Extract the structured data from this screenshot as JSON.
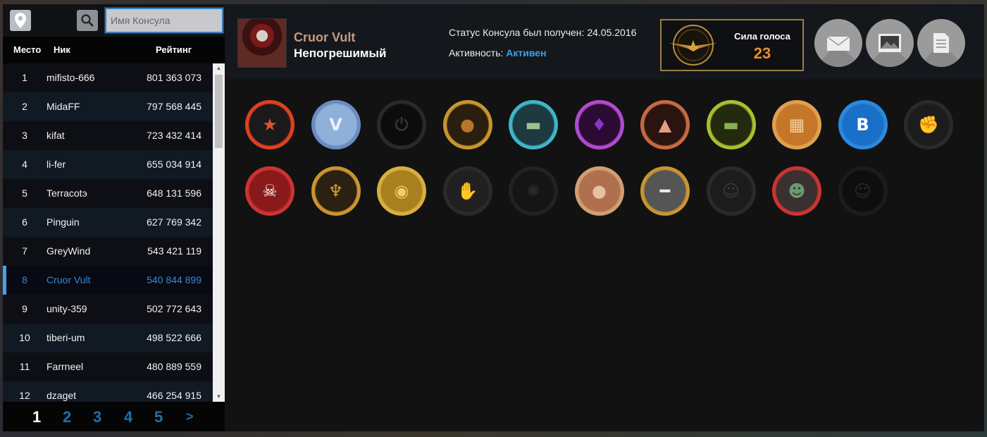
{
  "search": {
    "placeholder": "Имя Консула"
  },
  "table": {
    "headers": {
      "place": "Место",
      "nick": "Ник",
      "rating": "Рейтинг"
    },
    "rows": [
      {
        "place": "1",
        "nick": "mifisto-666",
        "rating": "801 363 073"
      },
      {
        "place": "2",
        "nick": "MidaFF",
        "rating": "797 568 445"
      },
      {
        "place": "3",
        "nick": "kifat",
        "rating": "723 432 414"
      },
      {
        "place": "4",
        "nick": "li-fer",
        "rating": "655 034 914"
      },
      {
        "place": "5",
        "nick": "Terracotэ",
        "rating": "648 131 596"
      },
      {
        "place": "6",
        "nick": "Pinguin",
        "rating": "627 769 342"
      },
      {
        "place": "7",
        "nick": "GreyWind",
        "rating": "543 421 119"
      },
      {
        "place": "8",
        "nick": "Cruor Vult",
        "rating": "540 844 899",
        "active": true
      },
      {
        "place": "9",
        "nick": "unity-359",
        "rating": "502 772 643"
      },
      {
        "place": "10",
        "nick": "tiberi-um",
        "rating": "498 522 666"
      },
      {
        "place": "11",
        "nick": "Farrneel",
        "rating": "480 889 559"
      },
      {
        "place": "12",
        "nick": "dzaget",
        "rating": "466 254 915"
      }
    ]
  },
  "pager": {
    "pages": [
      "1",
      "2",
      "3",
      "4",
      "5"
    ],
    "next": ">",
    "current": "1"
  },
  "profile": {
    "name": "Cruor Vult",
    "title": "Непогрешимый",
    "status_prefix": "Статус Консула был получен: ",
    "status_date": "24.05.2016",
    "activity_label": "Активность: ",
    "activity_value": "Активен",
    "vote_label": "Сила голоса",
    "vote_value": "23"
  },
  "colors": {
    "accent": "#3ea0e6",
    "name": "#c79b7e",
    "vote": "#e88e2e",
    "active_row": "#3b86d8"
  },
  "header_buttons": [
    "mail-icon",
    "image-icon",
    "document-icon"
  ],
  "badges": [
    {
      "name": "star-badge"
    },
    {
      "name": "v-badge"
    },
    {
      "name": "power-badge"
    },
    {
      "name": "person-badge"
    },
    {
      "name": "money-badge"
    },
    {
      "name": "crystal-badge"
    },
    {
      "name": "pyramid-badge"
    },
    {
      "name": "cash-badge"
    },
    {
      "name": "box-badge"
    },
    {
      "name": "vk-badge",
      "text": "B"
    },
    {
      "name": "fist-badge"
    },
    {
      "name": "skull-badge"
    },
    {
      "name": "eagle-badge"
    },
    {
      "name": "coins-badge"
    },
    {
      "name": "hand-badge"
    },
    {
      "name": "occult-badge"
    },
    {
      "name": "portrait-badge"
    },
    {
      "name": "minus-badge"
    },
    {
      "name": "tolstoy-badge"
    },
    {
      "name": "santa-badge"
    },
    {
      "name": "mask-badge"
    }
  ]
}
